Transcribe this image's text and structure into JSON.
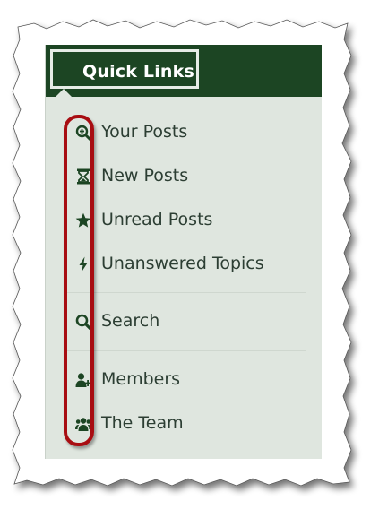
{
  "menu": {
    "title": "Quick Links",
    "items": [
      {
        "label": "Your Posts",
        "icon": "search-plus-icon"
      },
      {
        "label": "New Posts",
        "icon": "hourglass-icon"
      },
      {
        "label": "Unread Posts",
        "icon": "star-icon"
      },
      {
        "label": "Unanswered Topics",
        "icon": "bolt-icon"
      },
      {
        "label": "Search",
        "icon": "search-icon"
      },
      {
        "label": "Members",
        "icon": "user-plus-icon"
      },
      {
        "label": "The Team",
        "icon": "group-icon"
      }
    ]
  },
  "colors": {
    "header": "#1c4523",
    "panel": "#dfe6df",
    "text": "#2c3e33",
    "highlight": "#a80d12"
  }
}
